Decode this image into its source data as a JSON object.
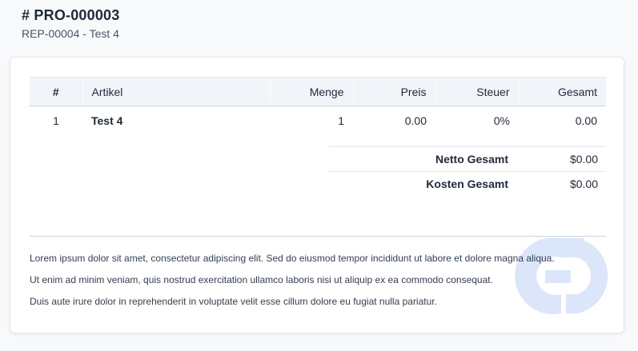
{
  "header": {
    "title": "# PRO-000003",
    "subtitle": "REP-00004 - Test 4"
  },
  "table": {
    "columns": [
      "#",
      "Artikel",
      "Menge",
      "Preis",
      "Steuer",
      "Gesamt"
    ],
    "rows": [
      {
        "num": "1",
        "artikel": "Test 4",
        "menge": "1",
        "preis": "0.00",
        "steuer": "0%",
        "gesamt": "0.00"
      }
    ]
  },
  "totals": {
    "net_label": "Netto Gesamt",
    "net_value": "$0.00",
    "cost_label": "Kosten Gesamt",
    "cost_value": "$0.00"
  },
  "notes": [
    "Lorem ipsum dolor sit amet, consectetur adipiscing elit. Sed do eiusmod tempor incididunt ut labore et dolore magna aliqua.",
    "Ut enim ad minim veniam, quis nostrud exercitation ullamco laboris nisi ut aliquip ex ea commodo consequat.",
    "Duis aute irure dolor in reprehenderit in voluptate velit esse cillum dolore eu fugiat nulla pariatur."
  ],
  "colors": {
    "accent_watermark": "#dbe6fb",
    "header_bg": "#f1f5f9",
    "text": "#1e293b"
  },
  "icons": {
    "watermark": "brand-logo-watermark"
  }
}
